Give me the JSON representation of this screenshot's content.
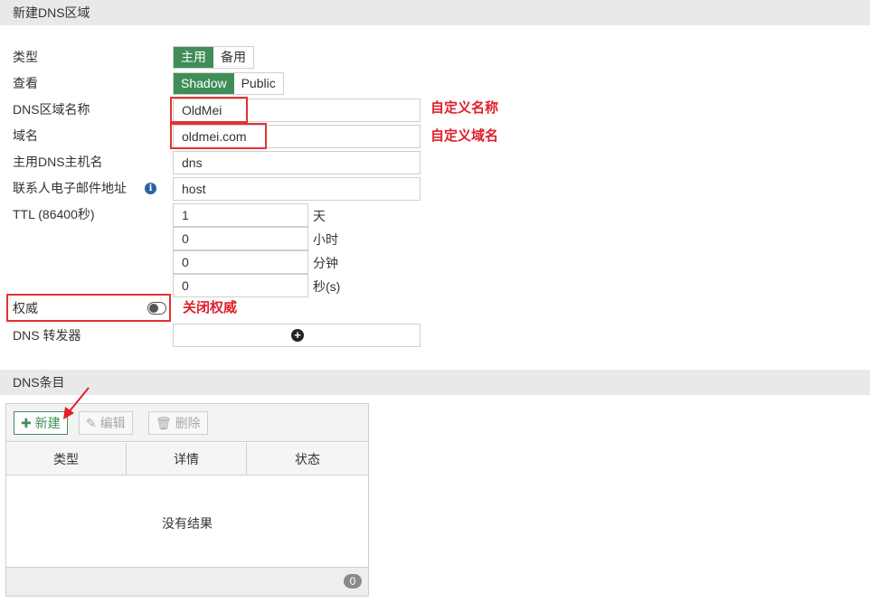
{
  "header": {
    "title": "新建DNS区域"
  },
  "form": {
    "type": {
      "label": "类型",
      "options": [
        "主用",
        "备用"
      ],
      "selected": "主用"
    },
    "view": {
      "label": "查看",
      "options": [
        "Shadow",
        "Public"
      ],
      "selected": "Shadow"
    },
    "zone_name": {
      "label": "DNS区域名称",
      "value": "OldMei"
    },
    "domain": {
      "label": "域名",
      "value": "oldmei.com"
    },
    "primary_host": {
      "label": "主用DNS主机名",
      "value": "dns"
    },
    "contact_email": {
      "label": "联系人电子邮件地址",
      "value": "host"
    },
    "ttl": {
      "label": "TTL (86400秒)",
      "days": "1",
      "hours": "0",
      "minutes": "0",
      "seconds": "0",
      "units": {
        "days": "天",
        "hours": "小时",
        "minutes": "分钟",
        "seconds": "秒(s)"
      }
    },
    "authoritative": {
      "label": "权威",
      "enabled": false
    },
    "forwarder": {
      "label": "DNS 转发器"
    }
  },
  "annotations": {
    "zone_name": "自定义名称",
    "domain": "自定义域名",
    "authoritative": "关闭权威"
  },
  "entries": {
    "title": "DNS条目",
    "toolbar": {
      "new": "新建",
      "edit": "编辑",
      "delete": "删除"
    },
    "columns": [
      "类型",
      "详情",
      "状态"
    ],
    "empty_text": "没有结果",
    "count": "0"
  },
  "colors": {
    "accent": "#3f8e57",
    "annotation": "#e0202a",
    "header_bg": "#e9e9e9"
  }
}
